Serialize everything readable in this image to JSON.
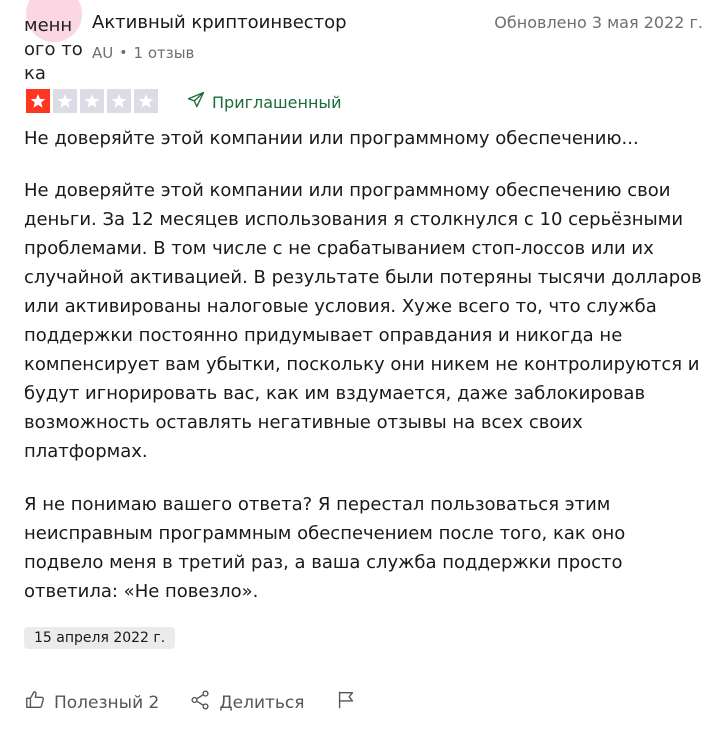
{
  "reviewer": {
    "avatar_text": "менн ого тока",
    "name": "Активный криптоинвестор",
    "country": "AU",
    "reviews_count": "1 отзыв"
  },
  "updated": "Обновлено 3 мая 2022 г.",
  "rating": {
    "value": 1,
    "max": 5,
    "active_color": "#ff3722",
    "inactive_color": "#dcdce6"
  },
  "invited_label": "Приглашенный",
  "review": {
    "title": "Не доверяйте этой компании или программному обеспечению...",
    "paragraph1": "Не доверяйте этой компании или программному обеспечению свои деньги. За 12 месяцев использования я столкнулся с 10 серьёзными проблемами. В том числе с не срабатыванием стоп-лоссов или их случайной активацией. В результате были потеряны тысячи долларов или активированы налоговые условия. Хуже всего то, что служба поддержки постоянно придумывает оправдания и никогда не компенсирует вам убытки, поскольку они никем не контролируются и будут игнорировать вас, как им вздумается, даже заблокировав возможность оставлять негативные отзывы на всех своих платформах.",
    "paragraph2": "Я не понимаю вашего ответа? Я перестал пользоваться этим неисправным программным обеспечением после того, как оно подвело меня в третий раз, а ваша служба поддержки просто ответила: «Не повезло».",
    "experience_date": "15 апреля 2022 г."
  },
  "actions": {
    "useful_label": "Полезный 2",
    "share_label": "Делиться"
  },
  "icons": {
    "useful": "thumbs-up-icon",
    "share": "share-icon",
    "report": "flag-icon",
    "invited": "send-icon",
    "star": "star-icon"
  }
}
